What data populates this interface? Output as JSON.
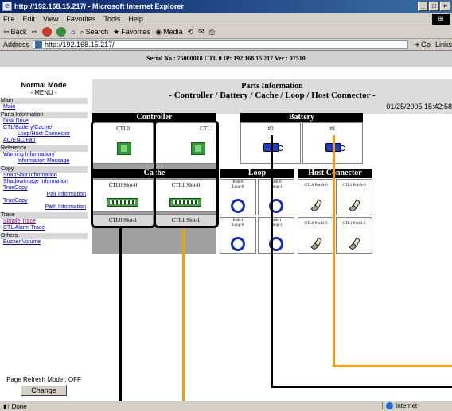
{
  "window": {
    "title": "http://192.168.15.217/ - Microsoft Internet Explorer"
  },
  "menubar": {
    "items": [
      "File",
      "Edit",
      "View",
      "Favorites",
      "Tools",
      "Help"
    ]
  },
  "toolbar": {
    "back": "Back",
    "search": "Search",
    "favorites": "Favorites",
    "media": "Media"
  },
  "address": {
    "label": "Address",
    "url": "http://192.168.15.217/",
    "go": "Go",
    "links": "Links"
  },
  "header": {
    "serial_info": "Serial No : 75000018   CTL 0   IP: 192.168.15.217   Ver : 07510"
  },
  "nav": {
    "mode": "Normal Mode",
    "menu_title": "- MENU -",
    "sections": [
      {
        "title": "Main",
        "items": [
          "Main"
        ]
      },
      {
        "title": "Parts Information",
        "items": [
          "Disk Drive",
          "CTL/Battery/Cache/",
          "Loop/Host Connector",
          "AC/ENC/Fan"
        ]
      },
      {
        "title": "Reference",
        "items": [
          "Warning Information/",
          "Information Message"
        ]
      },
      {
        "title": "Copy",
        "items": [
          "SnapShot Information",
          "ShadowImage Information",
          "TrueCopy",
          "Pair Information",
          "TrueCopy",
          "Path Information"
        ]
      },
      {
        "title": "Trace",
        "items": [
          "Simple Trace",
          "CTL Alarm Trace"
        ]
      },
      {
        "title": "Others",
        "items": [
          "Buzzer Volume"
        ]
      }
    ],
    "refresh_label": "Page Refresh Mode : OFF",
    "change_button": "Change"
  },
  "main": {
    "title": "Parts Information",
    "subtitle": "- Controller / Battery / Cache / Loop / Host Connector -",
    "timestamp": "01/25/2005 15:42:58",
    "controller": {
      "header": "Controller",
      "units": [
        "CTL0",
        "CTL1"
      ]
    },
    "battery": {
      "header": "Battery",
      "units": [
        "#0",
        "#1"
      ]
    },
    "cache": {
      "header": "Cache",
      "units": [
        "CTL0 Slot-0",
        "CTL1 Slot-0",
        "CTL0 Slot-1",
        "CTL1 Slot-1"
      ]
    },
    "loop": {
      "header": "Loop",
      "units": [
        {
          "path": "Path-0",
          "loop": "Loop-0"
        },
        {
          "path": "Path-0",
          "loop": "Loop-1"
        },
        {
          "path": "Path-1",
          "loop": "Loop-0"
        },
        {
          "path": "Path-1",
          "loop": "Loop-1"
        }
      ]
    },
    "host_connector": {
      "header": "Host Connector",
      "units": [
        "CTL0 PortA-0",
        "CTL1 PortA-0",
        "CTL0 PortB-0",
        "CTL1 PortB-0"
      ]
    }
  },
  "status": {
    "left": "Done",
    "zone": "Internet"
  },
  "colors": {
    "orange_wire": "#f5a000",
    "black_wire": "#000000",
    "battery_blue": "#1e3cc8",
    "loop_blue": "#1530c0",
    "board_green": "#2f9a3a"
  }
}
